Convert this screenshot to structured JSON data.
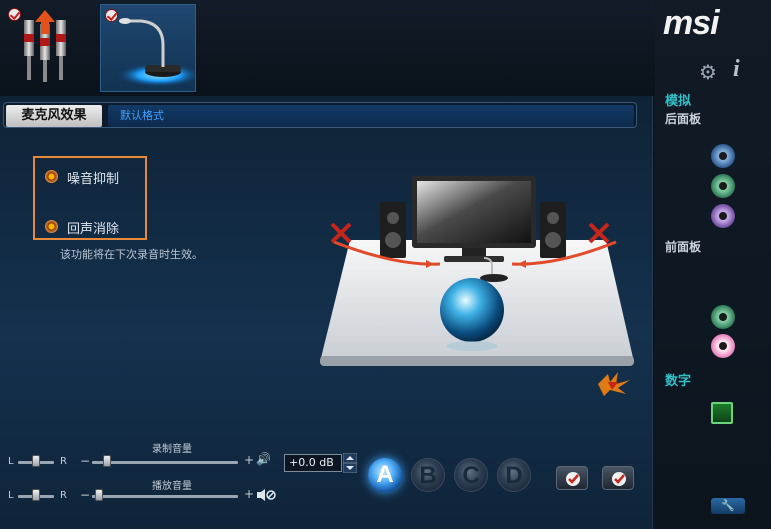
{
  "tabs": {
    "effect_label": "麦克风效果",
    "format_label": "默认格式"
  },
  "options": {
    "noise_label": "噪音抑制",
    "echo_label": "回声消除",
    "hint": "该功能将在下次录音时生效。"
  },
  "volume": {
    "record_label": "录制音量",
    "playback_label": "播放音量",
    "left_letter": "L",
    "right_letter": "R",
    "db_value": "+0.0 dB"
  },
  "ab_buttons": [
    "A",
    "B",
    "C",
    "D"
  ],
  "sidebar": {
    "logo": "msi",
    "analog_title": "模拟",
    "back_panel": "后面板",
    "front_panel": "前面板",
    "digital_title": "数字"
  },
  "colors": {
    "accent": "#2ec0c8",
    "highlight_box": "#e98a3a",
    "active_button": "#57b4ff"
  },
  "icons": {
    "settings": "gear-icon",
    "info": "info-icon",
    "speaker": "speaker-icon",
    "mute": "mute-icon",
    "wrench": "wrench-icon"
  }
}
